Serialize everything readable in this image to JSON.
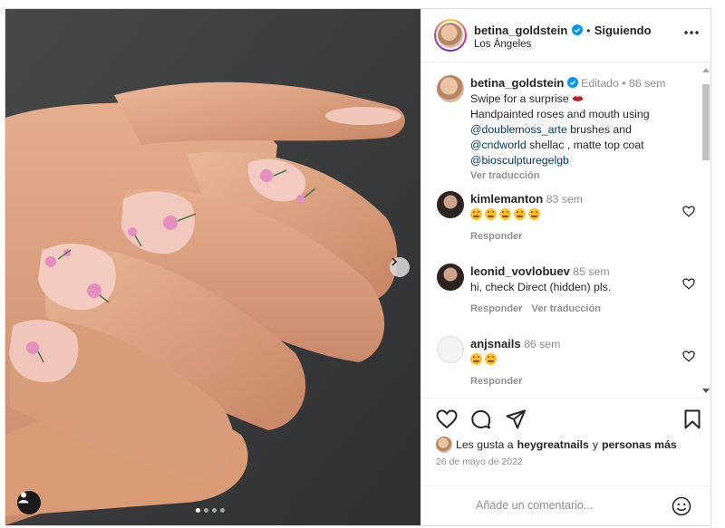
{
  "post": {
    "username": "betina_goldstein",
    "follow_status": "Siguiendo",
    "separator": "•",
    "location": "Los Ángeles"
  },
  "caption": {
    "username": "betina_goldstein",
    "edited": "Editado",
    "separator": "•",
    "time": "86 sem",
    "line1": "Swipe for a surprise",
    "line2": "Handpainted roses and mouth using",
    "mention1": "@doublemoss_arte",
    "line3": "brushes and",
    "mention2": "@cndworld",
    "line4": "shellac , matte top coat",
    "mention3": "@biosculpturegelgb",
    "translate": "Ver traducción"
  },
  "comments": [
    {
      "username": "kimlemanton",
      "time": "83 sem",
      "text": "",
      "emoji_count": 5,
      "reply": "Responder",
      "translate": ""
    },
    {
      "username": "leonid_vovlobuev",
      "time": "85 sem",
      "text": "hi, check Direct (hidden) pls.",
      "emoji_count": 0,
      "reply": "Responder",
      "translate": "Ver traducción"
    },
    {
      "username": "anjsnails",
      "time": "86 sem",
      "text": "",
      "emoji_count": 2,
      "reply": "Responder",
      "translate": ""
    }
  ],
  "likes": {
    "prefix": "Les gusta a",
    "user": "heygreatnails",
    "and": "y",
    "others": "personas más"
  },
  "date": "26 de mayo de 2022",
  "comment_box": {
    "placeholder": "Añade un comentario..."
  },
  "carousel": {
    "total": 4,
    "active": 1
  },
  "colors": {
    "link": "#00376b",
    "verified": "#0095f6",
    "muted": "#8e8e8e"
  }
}
